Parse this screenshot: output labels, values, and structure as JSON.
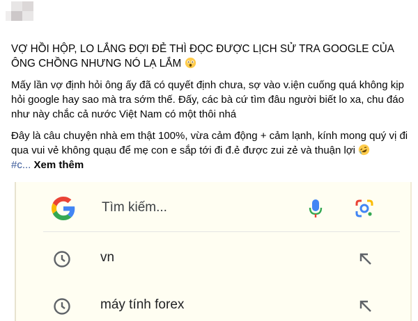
{
  "post": {
    "headline": "VỢ HỒI HỘP, LO LẮNG ĐỢI ĐẺ THÌ ĐỌC ĐƯỢC LỊCH SỬ TRA GOOGLE CỦA ÔNG CHỒNG NHƯNG NÓ LẠ LẮM",
    "paragraph_1": "Mấy lần vợ định hỏi ông ấy đã có quyết định chưa, sợ vào v.iện cuống quá không kịp hỏi google hay sao mà tra sớm thế. Đấy, các bà cứ tìm đâu người biết lo xa, chu đáo như này chắc cả nước Việt Nam có một thôi nhá",
    "paragraph_2": "Đây là câu chuyện nhà em thật 100%, vừa cảm động + cảm lạnh, kính mong quý vị đi qua vui vẻ không quạu để mẹ con e sắp tới đi đ.ẻ được zui zẻ và thuận lợi",
    "hashtag": "#c...",
    "see_more": "Xem thêm"
  },
  "google_screenshot": {
    "search_placeholder": "Tìm kiếm...",
    "history": [
      {
        "text": "vn"
      },
      {
        "text": "máy tính forex"
      }
    ]
  },
  "colors": {
    "hashtag": "#385898",
    "google_blue": "#4285F4",
    "google_red": "#EA4335",
    "google_yellow": "#FBBC05",
    "google_green": "#34A853"
  }
}
